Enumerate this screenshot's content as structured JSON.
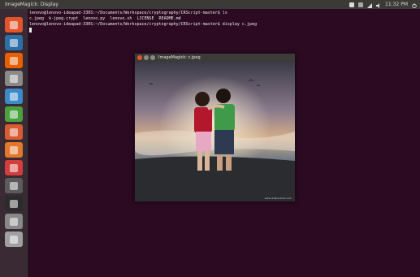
{
  "top_panel": {
    "window_title": "ImageMagick: Display",
    "clock": "11:32 PM",
    "tray_icons": [
      "dropbox-icon",
      "keyboard-icon",
      "network-icon",
      "volume-icon"
    ]
  },
  "launcher": {
    "items": [
      {
        "name": "dash-icon",
        "color": "#e2552c"
      },
      {
        "name": "files-icon",
        "color": "#2d6fa8"
      },
      {
        "name": "firefox-icon",
        "color": "#e66000"
      },
      {
        "name": "generic-app-icon",
        "color": "#8a8a8a"
      },
      {
        "name": "writer-icon",
        "color": "#3b8ac9"
      },
      {
        "name": "calc-icon",
        "color": "#4ba040"
      },
      {
        "name": "impress-icon",
        "color": "#d85c32"
      },
      {
        "name": "software-center-icon",
        "color": "#e3782c"
      },
      {
        "name": "amazon-icon",
        "color": "#d23d3d"
      },
      {
        "name": "settings-icon",
        "color": "#5b5b5b"
      },
      {
        "name": "terminal-icon",
        "color": "#2b2b2b"
      },
      {
        "name": "workspaces-icon",
        "color": "#888888"
      },
      {
        "name": "trash-icon",
        "color": "#a0a0a0"
      }
    ]
  },
  "terminal": {
    "lines": [
      "lenovo@lenovo-ideapad-330S:~/Documents/Workspace/cryptography/CRScript-master$ ls",
      "c.jpeg  k-jpeg.crypt  lenovo.py  lenovo.sh  LICENSE  README.md",
      "lenovo@lenovo-ideapad-330S:~/Documents/Workspace/cryptography/CRScript-master$ display c.jpeg"
    ]
  },
  "viewer": {
    "title": "ImageMagick: c.jpeg",
    "watermark": "www.dreamstime.com"
  }
}
